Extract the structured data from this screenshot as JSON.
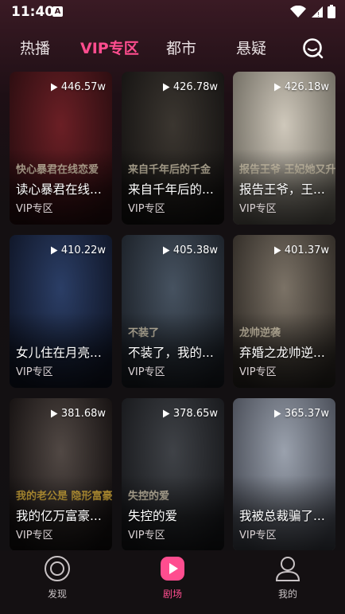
{
  "status": {
    "time": "11:40",
    "a_badge": "A"
  },
  "tabs": [
    {
      "label": "热播",
      "active": false
    },
    {
      "label": "VIP专区",
      "active": true
    },
    {
      "label": "都市",
      "active": false
    },
    {
      "label": "悬疑",
      "active": false
    }
  ],
  "cards": [
    {
      "views": "446.57w",
      "title": "读心暴君在线...",
      "tag": "VIP专区",
      "deco": "快心暴君在线恋爱",
      "c1": "#6b1f25",
      "c2": "#2a0d10"
    },
    {
      "views": "426.78w",
      "title": "来自千年后的...",
      "tag": "VIP专区",
      "deco": "来自千年后的千金",
      "c1": "#3b3630",
      "c2": "#151312"
    },
    {
      "views": "426.18w",
      "title": "报告王爷，王...",
      "tag": "VIP专区",
      "deco": "报告王爷 王妃她又升级了",
      "c1": "#cfc8bb",
      "c2": "#6e6a60"
    },
    {
      "views": "410.22w",
      "title": "女儿住在月亮...",
      "tag": "VIP专区",
      "deco": "",
      "c1": "#2b3e66",
      "c2": "#0f1526"
    },
    {
      "views": "405.38w",
      "title": "不装了，我的...",
      "tag": "VIP专区",
      "deco": "不装了",
      "c1": "#465260",
      "c2": "#1b2027"
    },
    {
      "views": "401.37w",
      "title": "弃婚之龙帅逆...",
      "tag": "VIP专区",
      "deco": "龙帅逆袭",
      "c1": "#7b7266",
      "c2": "#2f2a25"
    },
    {
      "views": "381.68w",
      "title": "我的亿万富豪...",
      "tag": "VIP专区",
      "deco": "我的老公是 隐形富豪",
      "c1": "#514844",
      "c2": "#141010"
    },
    {
      "views": "378.65w",
      "title": "失控的爱",
      "tag": "VIP专区",
      "deco": "失控的爱",
      "c1": "#3f4247",
      "c2": "#17181b"
    },
    {
      "views": "365.37w",
      "title": "我被总裁骗了...",
      "tag": "VIP专区",
      "deco": "",
      "c1": "#9aa1ad",
      "c2": "#474b55"
    }
  ],
  "nav": [
    {
      "label": "发现",
      "active": false
    },
    {
      "label": "剧场",
      "active": true
    },
    {
      "label": "我的",
      "active": false
    }
  ],
  "colors": {
    "accent": "#ff4d8f",
    "background": "#141012"
  }
}
